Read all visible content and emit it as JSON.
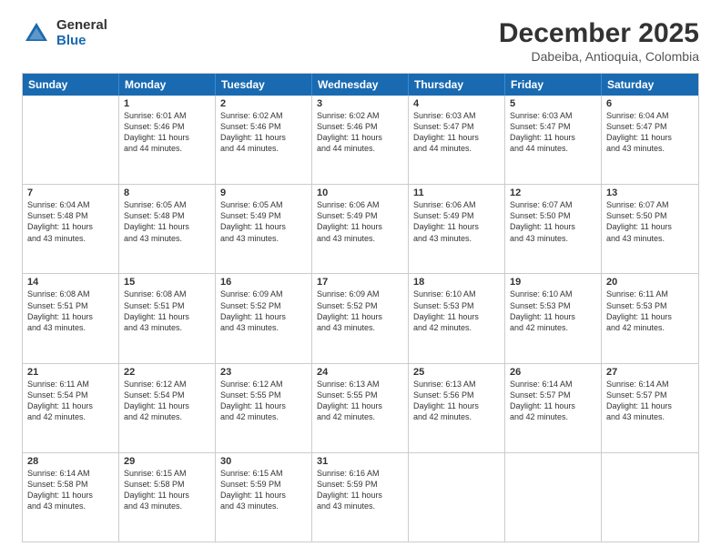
{
  "header": {
    "logo_general": "General",
    "logo_blue": "Blue",
    "month_title": "December 2025",
    "location": "Dabeiba, Antioquia, Colombia"
  },
  "days_of_week": [
    "Sunday",
    "Monday",
    "Tuesday",
    "Wednesday",
    "Thursday",
    "Friday",
    "Saturday"
  ],
  "weeks": [
    [
      {
        "day": "",
        "lines": []
      },
      {
        "day": "1",
        "lines": [
          "Sunrise: 6:01 AM",
          "Sunset: 5:46 PM",
          "Daylight: 11 hours",
          "and 44 minutes."
        ]
      },
      {
        "day": "2",
        "lines": [
          "Sunrise: 6:02 AM",
          "Sunset: 5:46 PM",
          "Daylight: 11 hours",
          "and 44 minutes."
        ]
      },
      {
        "day": "3",
        "lines": [
          "Sunrise: 6:02 AM",
          "Sunset: 5:46 PM",
          "Daylight: 11 hours",
          "and 44 minutes."
        ]
      },
      {
        "day": "4",
        "lines": [
          "Sunrise: 6:03 AM",
          "Sunset: 5:47 PM",
          "Daylight: 11 hours",
          "and 44 minutes."
        ]
      },
      {
        "day": "5",
        "lines": [
          "Sunrise: 6:03 AM",
          "Sunset: 5:47 PM",
          "Daylight: 11 hours",
          "and 44 minutes."
        ]
      },
      {
        "day": "6",
        "lines": [
          "Sunrise: 6:04 AM",
          "Sunset: 5:47 PM",
          "Daylight: 11 hours",
          "and 43 minutes."
        ]
      }
    ],
    [
      {
        "day": "7",
        "lines": [
          "Sunrise: 6:04 AM",
          "Sunset: 5:48 PM",
          "Daylight: 11 hours",
          "and 43 minutes."
        ]
      },
      {
        "day": "8",
        "lines": [
          "Sunrise: 6:05 AM",
          "Sunset: 5:48 PM",
          "Daylight: 11 hours",
          "and 43 minutes."
        ]
      },
      {
        "day": "9",
        "lines": [
          "Sunrise: 6:05 AM",
          "Sunset: 5:49 PM",
          "Daylight: 11 hours",
          "and 43 minutes."
        ]
      },
      {
        "day": "10",
        "lines": [
          "Sunrise: 6:06 AM",
          "Sunset: 5:49 PM",
          "Daylight: 11 hours",
          "and 43 minutes."
        ]
      },
      {
        "day": "11",
        "lines": [
          "Sunrise: 6:06 AM",
          "Sunset: 5:49 PM",
          "Daylight: 11 hours",
          "and 43 minutes."
        ]
      },
      {
        "day": "12",
        "lines": [
          "Sunrise: 6:07 AM",
          "Sunset: 5:50 PM",
          "Daylight: 11 hours",
          "and 43 minutes."
        ]
      },
      {
        "day": "13",
        "lines": [
          "Sunrise: 6:07 AM",
          "Sunset: 5:50 PM",
          "Daylight: 11 hours",
          "and 43 minutes."
        ]
      }
    ],
    [
      {
        "day": "14",
        "lines": [
          "Sunrise: 6:08 AM",
          "Sunset: 5:51 PM",
          "Daylight: 11 hours",
          "and 43 minutes."
        ]
      },
      {
        "day": "15",
        "lines": [
          "Sunrise: 6:08 AM",
          "Sunset: 5:51 PM",
          "Daylight: 11 hours",
          "and 43 minutes."
        ]
      },
      {
        "day": "16",
        "lines": [
          "Sunrise: 6:09 AM",
          "Sunset: 5:52 PM",
          "Daylight: 11 hours",
          "and 43 minutes."
        ]
      },
      {
        "day": "17",
        "lines": [
          "Sunrise: 6:09 AM",
          "Sunset: 5:52 PM",
          "Daylight: 11 hours",
          "and 43 minutes."
        ]
      },
      {
        "day": "18",
        "lines": [
          "Sunrise: 6:10 AM",
          "Sunset: 5:53 PM",
          "Daylight: 11 hours",
          "and 42 minutes."
        ]
      },
      {
        "day": "19",
        "lines": [
          "Sunrise: 6:10 AM",
          "Sunset: 5:53 PM",
          "Daylight: 11 hours",
          "and 42 minutes."
        ]
      },
      {
        "day": "20",
        "lines": [
          "Sunrise: 6:11 AM",
          "Sunset: 5:53 PM",
          "Daylight: 11 hours",
          "and 42 minutes."
        ]
      }
    ],
    [
      {
        "day": "21",
        "lines": [
          "Sunrise: 6:11 AM",
          "Sunset: 5:54 PM",
          "Daylight: 11 hours",
          "and 42 minutes."
        ]
      },
      {
        "day": "22",
        "lines": [
          "Sunrise: 6:12 AM",
          "Sunset: 5:54 PM",
          "Daylight: 11 hours",
          "and 42 minutes."
        ]
      },
      {
        "day": "23",
        "lines": [
          "Sunrise: 6:12 AM",
          "Sunset: 5:55 PM",
          "Daylight: 11 hours",
          "and 42 minutes."
        ]
      },
      {
        "day": "24",
        "lines": [
          "Sunrise: 6:13 AM",
          "Sunset: 5:55 PM",
          "Daylight: 11 hours",
          "and 42 minutes."
        ]
      },
      {
        "day": "25",
        "lines": [
          "Sunrise: 6:13 AM",
          "Sunset: 5:56 PM",
          "Daylight: 11 hours",
          "and 42 minutes."
        ]
      },
      {
        "day": "26",
        "lines": [
          "Sunrise: 6:14 AM",
          "Sunset: 5:57 PM",
          "Daylight: 11 hours",
          "and 42 minutes."
        ]
      },
      {
        "day": "27",
        "lines": [
          "Sunrise: 6:14 AM",
          "Sunset: 5:57 PM",
          "Daylight: 11 hours",
          "and 43 minutes."
        ]
      }
    ],
    [
      {
        "day": "28",
        "lines": [
          "Sunrise: 6:14 AM",
          "Sunset: 5:58 PM",
          "Daylight: 11 hours",
          "and 43 minutes."
        ]
      },
      {
        "day": "29",
        "lines": [
          "Sunrise: 6:15 AM",
          "Sunset: 5:58 PM",
          "Daylight: 11 hours",
          "and 43 minutes."
        ]
      },
      {
        "day": "30",
        "lines": [
          "Sunrise: 6:15 AM",
          "Sunset: 5:59 PM",
          "Daylight: 11 hours",
          "and 43 minutes."
        ]
      },
      {
        "day": "31",
        "lines": [
          "Sunrise: 6:16 AM",
          "Sunset: 5:59 PM",
          "Daylight: 11 hours",
          "and 43 minutes."
        ]
      },
      {
        "day": "",
        "lines": []
      },
      {
        "day": "",
        "lines": []
      },
      {
        "day": "",
        "lines": []
      }
    ]
  ]
}
